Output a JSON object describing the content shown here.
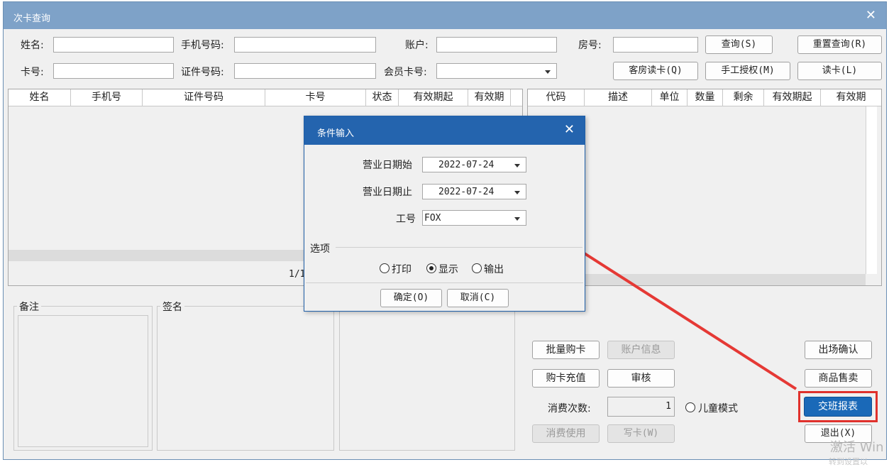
{
  "window": {
    "title": "次卡查询"
  },
  "search": {
    "name_label": "姓名:",
    "phone_label": "手机号码:",
    "account_label": "账户:",
    "room_label": "房号:",
    "card_label": "卡号:",
    "idcard_label": "证件号码:",
    "member_card_label": "会员卡号:",
    "query_button": "查询(S)",
    "reset_button": "重置查询(R)",
    "room_read_button": "客房读卡(Q)",
    "manual_auth_button": "手工授权(M)",
    "read_card_button": "读卡(L)"
  },
  "left_grid": {
    "columns": [
      "姓名",
      "手机号",
      "证件号码",
      "卡号",
      "状态",
      "有效期起",
      "有效期"
    ],
    "page_indicator": "1/1"
  },
  "right_grid": {
    "columns": [
      "代码",
      "描述",
      "单位",
      "数量",
      "剩余",
      "有效期起",
      "有效期"
    ]
  },
  "panels": {
    "remark": "备注",
    "signature": "签名"
  },
  "actions": {
    "batch_buy": "批量购卡",
    "account_info": "账户信息",
    "buy_recharge": "购卡充值",
    "audit": "审核",
    "consume_count_label": "消费次数:",
    "consume_count_value": "1",
    "child_mode": "儿童模式",
    "consume_use": "消费使用",
    "write_card": "写卡(W)",
    "exit_confirm": "出场确认",
    "goods_sale": "商品售卖",
    "shift_report": "交班报表",
    "exit": "退出(X)"
  },
  "dialog": {
    "title": "条件输入",
    "start_date_label": "营业日期始",
    "start_date": "2022-07-24",
    "end_date_label": "营业日期止",
    "end_date": "2022-07-24",
    "staff_label": "工号",
    "staff_value": "FOX",
    "options_label": "选项",
    "opt_print": "打印",
    "opt_show": "显示",
    "opt_export": "输出",
    "ok_button": "确定(O)",
    "cancel_button": "取消(C)"
  },
  "watermark": {
    "line1": "激活 Win",
    "line2": "转到设置以"
  },
  "colors": {
    "titlebar": "#7ea2c8",
    "dialog_title": "#2464ae",
    "primary": "#1a69b8",
    "arrow": "#e53935"
  }
}
